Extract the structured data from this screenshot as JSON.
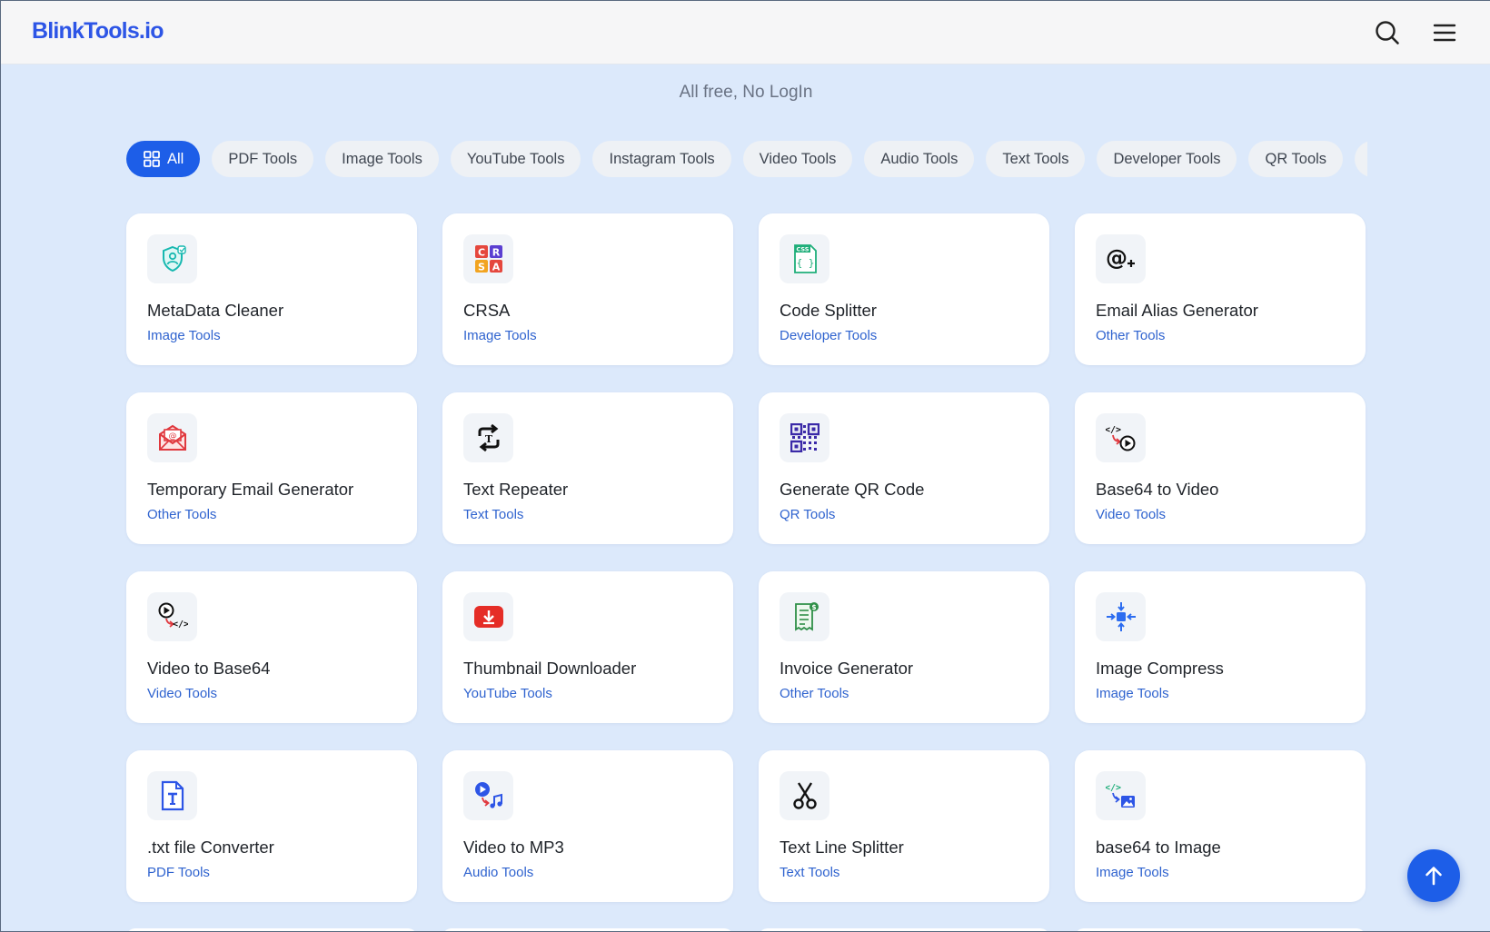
{
  "header": {
    "logo": "BlinkTools.io",
    "icons": [
      "search-icon",
      "menu-icon"
    ]
  },
  "tagline": "All free, No LogIn",
  "filters": [
    {
      "label": "All",
      "active": true,
      "icon": "grid-icon"
    },
    {
      "label": "PDF Tools"
    },
    {
      "label": "Image Tools"
    },
    {
      "label": "YouTube Tools"
    },
    {
      "label": "Instagram Tools"
    },
    {
      "label": "Video Tools"
    },
    {
      "label": "Audio Tools"
    },
    {
      "label": "Text Tools"
    },
    {
      "label": "Developer Tools"
    },
    {
      "label": "QR Tools"
    },
    {
      "label": ""
    }
  ],
  "tools": [
    {
      "title": "MetaData Cleaner",
      "category": "Image Tools",
      "icon": "metadata-cleaner-icon"
    },
    {
      "title": "CRSA",
      "category": "Image Tools",
      "icon": "crsa-icon"
    },
    {
      "title": "Code Splitter",
      "category": "Developer Tools",
      "icon": "css-file-icon"
    },
    {
      "title": "Email Alias Generator",
      "category": "Other Tools",
      "icon": "at-plus-icon"
    },
    {
      "title": "Temporary Email Generator",
      "category": "Other Tools",
      "icon": "envelope-icon"
    },
    {
      "title": "Text Repeater",
      "category": "Text Tools",
      "icon": "repeat-icon"
    },
    {
      "title": "Generate QR Code",
      "category": "QR Tools",
      "icon": "qr-code-icon"
    },
    {
      "title": "Base64 to Video",
      "category": "Video Tools",
      "icon": "code-to-video-icon"
    },
    {
      "title": "Video to Base64",
      "category": "Video Tools",
      "icon": "video-to-code-icon"
    },
    {
      "title": "Thumbnail Downloader",
      "category": "YouTube Tools",
      "icon": "youtube-download-icon"
    },
    {
      "title": "Invoice Generator",
      "category": "Other Tools",
      "icon": "invoice-icon"
    },
    {
      "title": "Image Compress",
      "category": "Image Tools",
      "icon": "compress-icon"
    },
    {
      "title": ".txt file Converter",
      "category": "PDF Tools",
      "icon": "txt-file-icon"
    },
    {
      "title": "Video to MP3",
      "category": "Audio Tools",
      "icon": "video-to-music-icon"
    },
    {
      "title": "Text Line Splitter",
      "category": "Text Tools",
      "icon": "scissors-icon"
    },
    {
      "title": "base64 to Image",
      "category": "Image Tools",
      "icon": "code-to-image-icon"
    }
  ],
  "fab_icon": "arrow-up-icon",
  "colors": {
    "accent": "#1d5ee8",
    "page_bg": "#dce9fb",
    "category_text": "#2f63cf"
  }
}
